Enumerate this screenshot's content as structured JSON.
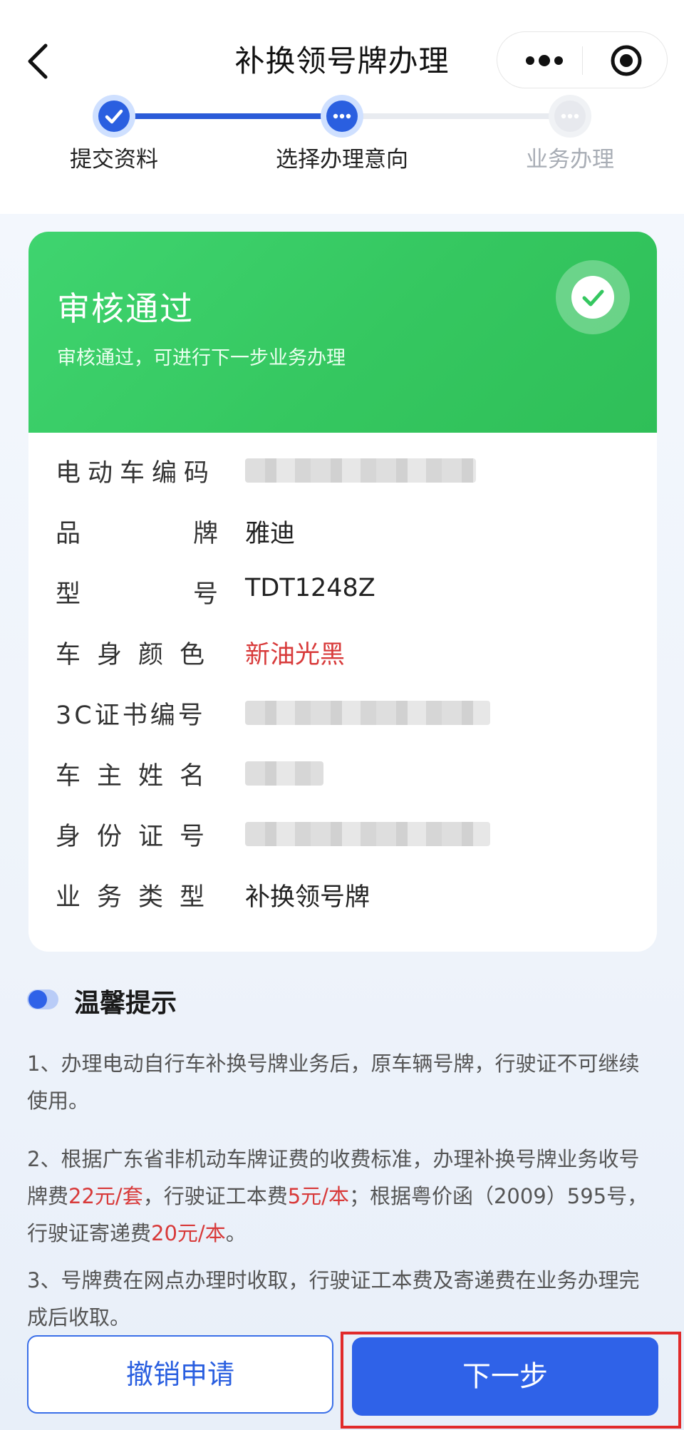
{
  "nav": {
    "title": "补换领号牌办理",
    "back_icon": "chevron-left-icon",
    "more_icon": "more-dots-icon",
    "close_icon": "target-circle-icon"
  },
  "stepper": {
    "steps": [
      {
        "label": "提交资料",
        "state": "done"
      },
      {
        "label": "选择办理意向",
        "state": "current"
      },
      {
        "label": "业务办理",
        "state": "pending"
      }
    ]
  },
  "status": {
    "title": "审核通过",
    "subtitle": "审核通过，可进行下一步业务办理",
    "icon": "check-circle-icon",
    "color": "#35c760"
  },
  "details": {
    "ev_code": {
      "label": "电动车编码",
      "value": ""
    },
    "brand": {
      "label_a": "品",
      "label_b": "牌",
      "value": "雅迪"
    },
    "model": {
      "label_a": "型",
      "label_b": "号",
      "value": "TDT1248Z"
    },
    "color": {
      "label": "车身颜色",
      "value": "新油光黑"
    },
    "cert_3c": {
      "label": "3C证书编号",
      "value": ""
    },
    "owner": {
      "label": "车主姓名",
      "value": ""
    },
    "id_number": {
      "label": "身份证号",
      "value": ""
    },
    "biz_type": {
      "label": "业务类型",
      "value": "补换领号牌"
    }
  },
  "tips": {
    "title": "温馨提示",
    "t1": "1、办理电动自行车补换号牌业务后，原车辆号牌，行驶证不可继续使用。",
    "t2_a": "2、根据广东省非机动车牌证费的收费标准，办理补换号牌业务收号牌费",
    "t2_fee1": "22元/套",
    "t2_b": "，行驶证工本费",
    "t2_fee2": "5元/本",
    "t2_c": "；根据粤价函（2009）595号，行驶证寄递费",
    "t2_fee3": "20元/本",
    "t2_d": "。",
    "t3": "3、号牌费在网点办理时收取，行驶证工本费及寄递费在业务办理完成后收取。"
  },
  "actions": {
    "cancel_label": "撤销申请",
    "next_label": "下一步",
    "accent": "#2f62e8"
  }
}
